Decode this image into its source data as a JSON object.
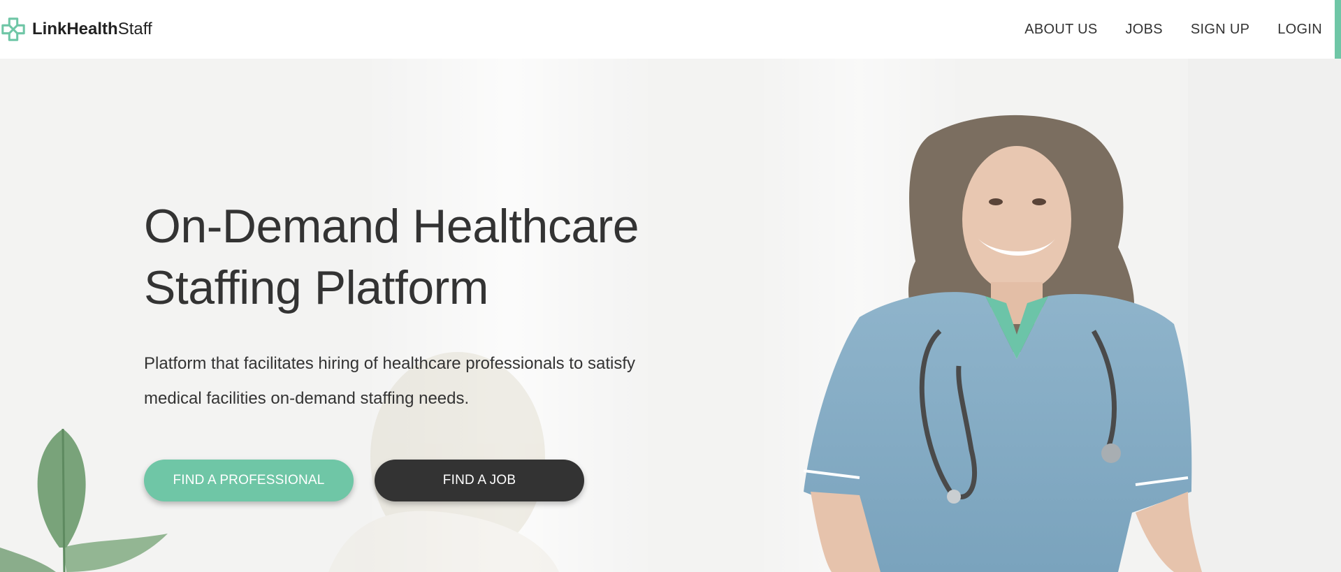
{
  "brand": {
    "name_bold": "LinkHealth",
    "name_light": "Staff",
    "logo_icon": "medical-cross-logo",
    "accent_color": "#6fc6a6"
  },
  "nav": {
    "items": [
      {
        "label": "ABOUT US"
      },
      {
        "label": "JOBS"
      },
      {
        "label": "SIGN UP"
      },
      {
        "label": "LOGIN"
      }
    ]
  },
  "hero": {
    "title_line1": "On-Demand Healthcare",
    "title_line2": "Staffing Platform",
    "description": "Platform that facilitates hiring of healthcare professionals to satisfy medical facilities on-demand staffing needs.",
    "primary_button": "FIND A PROFESSIONAL",
    "secondary_button": "FIND A JOB",
    "primary_color": "#6fc6a6",
    "secondary_color": "#333333"
  }
}
